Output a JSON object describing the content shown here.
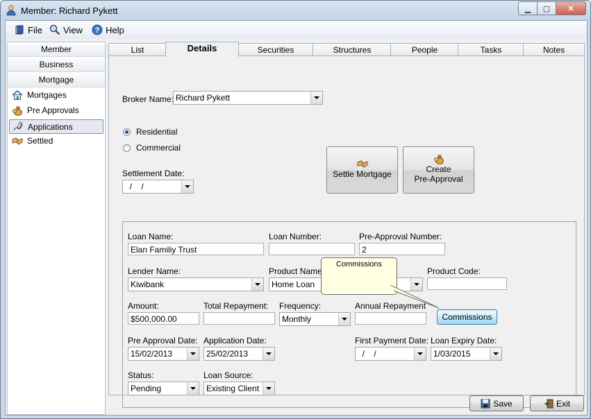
{
  "window": {
    "title": "Member: Richard Pykett"
  },
  "menu": {
    "file": "File",
    "view": "View",
    "help": "Help"
  },
  "nav": {
    "headers": [
      "Member",
      "Business",
      "Mortgage"
    ],
    "items": [
      {
        "label": "Mortgages",
        "icon": "house-icon"
      },
      {
        "label": "Pre Approvals",
        "icon": "money-bag-icon"
      },
      {
        "label": "Applications",
        "icon": "pen-document-icon"
      },
      {
        "label": "Settled",
        "icon": "handshake-icon"
      }
    ],
    "selected": "Applications"
  },
  "tabs": [
    "List",
    "Details",
    "Securities",
    "Structures",
    "People",
    "Tasks",
    "Notes"
  ],
  "active_tab": "Details",
  "form": {
    "broker_label": "Broker Name:",
    "broker_value": "Richard Pykett",
    "residential_label": "Residential",
    "commercial_label": "Commercial",
    "residential_selected": true,
    "settlement_label": "Settlement Date:",
    "settlement_value": "  /    /",
    "settle_button": "Settle Mortgage",
    "create_button_line1": "Create",
    "create_button_line2": "Pre-Approval",
    "loan_name_label": "Loan Name:",
    "loan_name_value": "Elan Familiy Trust",
    "loan_number_label": "Loan Number:",
    "loan_number_value": "",
    "preapproval_number_label": "Pre-Approval Number:",
    "preapproval_number_value": "2",
    "lender_label": "Lender Name:",
    "lender_value": "Kiwibank",
    "product_name_label": "Product Name",
    "product_name_value": "Home Loan",
    "product_code_label": "Product Code:",
    "product_code_value": "",
    "amount_label": "Amount:",
    "amount_value": "$500,000.00",
    "total_repayment_label": "Total Repayment:",
    "total_repayment_value": "",
    "frequency_label": "Frequency:",
    "frequency_value": "Monthly",
    "annual_repayment_label": "Annual Repayment",
    "annual_repayment_value": "",
    "commissions_button": "Commissions",
    "tooltip_text": "Commissions",
    "pre_approval_date_label": "Pre Approval Date:",
    "pre_approval_date_value": "15/02/2013",
    "application_date_label": "Application Date:",
    "application_date_value": "25/02/2013",
    "first_payment_label": "First Payment Date:",
    "first_payment_value": "  /    /",
    "loan_expiry_label": "Loan Expiry Date:",
    "loan_expiry_value": "1/03/2015",
    "status_label": "Status:",
    "status_value": "Pending",
    "loan_source_label": "Loan Source:",
    "loan_source_value": "Existing Client"
  },
  "footer": {
    "save": "Save",
    "exit": "Exit"
  }
}
